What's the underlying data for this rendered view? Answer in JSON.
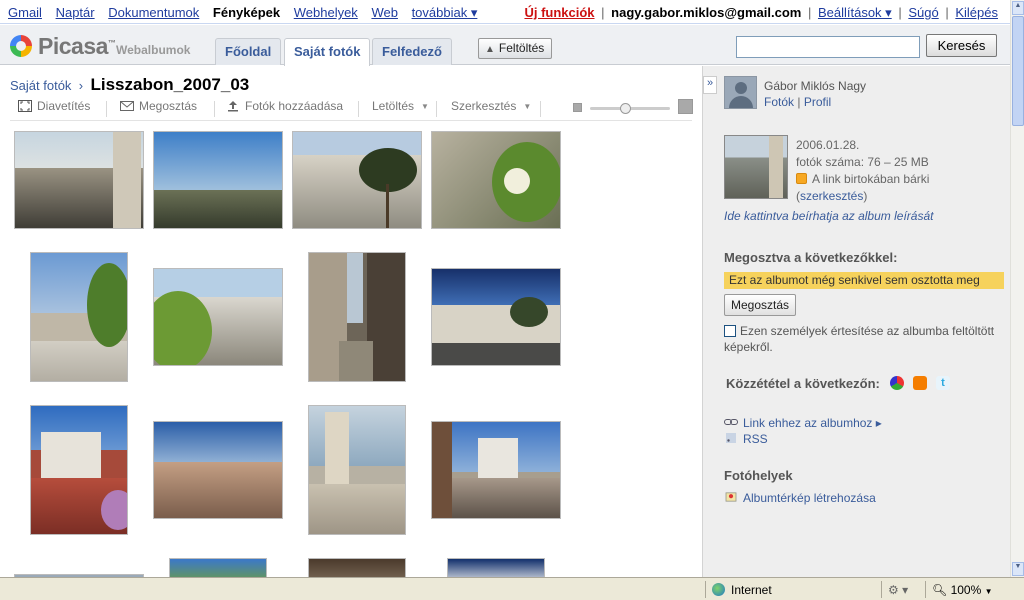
{
  "gbar": {
    "links": [
      "Gmail",
      "Naptár",
      "Dokumentumok",
      "Fényképek",
      "Webhelyek",
      "Web",
      "továbbiak ▾"
    ],
    "new_features": "Új funkciók",
    "email": "nagy.gabor.miklos@gmail.com",
    "sep": "|",
    "settings": "Beállítások ▾",
    "help": "Súgó",
    "logout": "Kilépés"
  },
  "header": {
    "logo_name": "Picasa",
    "logo_tm": "™",
    "logo_sub": "Webalbumok",
    "tabs": [
      "Főoldal",
      "Saját fotók",
      "Felfedező"
    ],
    "upload": "Feltöltés",
    "search_placeholder": "",
    "search_button": "Keresés"
  },
  "breadcrumb": {
    "parent": "Saját fotók",
    "sep": "›",
    "title": "Lisszabon_2007_03"
  },
  "toolbar": {
    "slideshow": "Diavetítés",
    "share": "Megosztás",
    "add_photos": "Fotók hozzáadása",
    "download": "Letöltés",
    "edit": "Szerkesztés"
  },
  "sidebar": {
    "user_name": "Gábor Miklós Nagy",
    "photos_link": "Fotók",
    "link_sep": "|",
    "profile_link": "Profil",
    "album_date": "2006.01.28.",
    "album_count": "fotók száma: 76 – 25 MB",
    "visibility": "A link birtokában bárki",
    "edit_prefix": "(",
    "edit_link": "szerkesztés",
    "edit_suffix": ")",
    "desc_link": "Ide kattintva beírhatja az album leírását",
    "shared_heading": "Megosztva a következőkkel:",
    "shared_notice": "Ezt az albumot még senkivel sem osztotta meg",
    "share_button": "Megosztás",
    "notify_text": "Ezen személyek értesítése az albumba feltöltött képekről.",
    "publish_heading": "Közzététel a következőn:",
    "album_link": "Link ehhez az albumhoz ▸",
    "rss": "RSS",
    "places_heading": "Fotóhelyek",
    "map_link": "Albumtérkép létrehozása"
  },
  "statusbar": {
    "zone": "Internet",
    "zoom": "100%"
  }
}
